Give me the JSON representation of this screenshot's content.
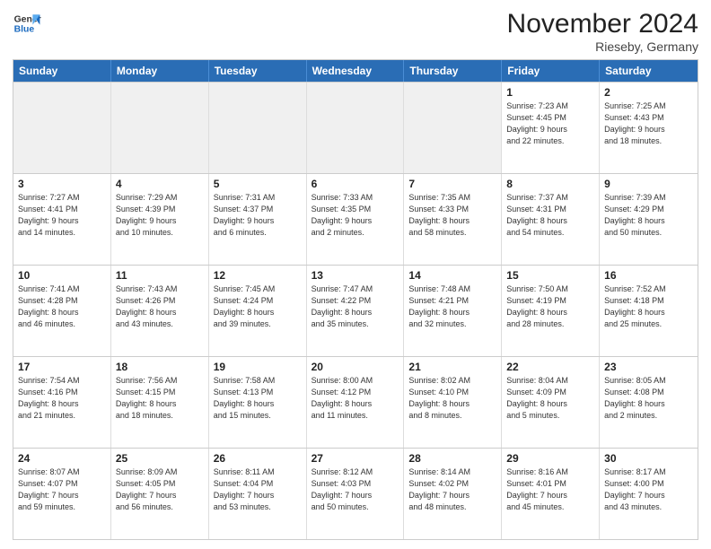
{
  "header": {
    "logo_line1": "General",
    "logo_line2": "Blue",
    "month_title": "November 2024",
    "location": "Rieseby, Germany"
  },
  "weekdays": [
    "Sunday",
    "Monday",
    "Tuesday",
    "Wednesday",
    "Thursday",
    "Friday",
    "Saturday"
  ],
  "weeks": [
    [
      {
        "day": "",
        "info": ""
      },
      {
        "day": "",
        "info": ""
      },
      {
        "day": "",
        "info": ""
      },
      {
        "day": "",
        "info": ""
      },
      {
        "day": "",
        "info": ""
      },
      {
        "day": "1",
        "info": "Sunrise: 7:23 AM\nSunset: 4:45 PM\nDaylight: 9 hours\nand 22 minutes."
      },
      {
        "day": "2",
        "info": "Sunrise: 7:25 AM\nSunset: 4:43 PM\nDaylight: 9 hours\nand 18 minutes."
      }
    ],
    [
      {
        "day": "3",
        "info": "Sunrise: 7:27 AM\nSunset: 4:41 PM\nDaylight: 9 hours\nand 14 minutes."
      },
      {
        "day": "4",
        "info": "Sunrise: 7:29 AM\nSunset: 4:39 PM\nDaylight: 9 hours\nand 10 minutes."
      },
      {
        "day": "5",
        "info": "Sunrise: 7:31 AM\nSunset: 4:37 PM\nDaylight: 9 hours\nand 6 minutes."
      },
      {
        "day": "6",
        "info": "Sunrise: 7:33 AM\nSunset: 4:35 PM\nDaylight: 9 hours\nand 2 minutes."
      },
      {
        "day": "7",
        "info": "Sunrise: 7:35 AM\nSunset: 4:33 PM\nDaylight: 8 hours\nand 58 minutes."
      },
      {
        "day": "8",
        "info": "Sunrise: 7:37 AM\nSunset: 4:31 PM\nDaylight: 8 hours\nand 54 minutes."
      },
      {
        "day": "9",
        "info": "Sunrise: 7:39 AM\nSunset: 4:29 PM\nDaylight: 8 hours\nand 50 minutes."
      }
    ],
    [
      {
        "day": "10",
        "info": "Sunrise: 7:41 AM\nSunset: 4:28 PM\nDaylight: 8 hours\nand 46 minutes."
      },
      {
        "day": "11",
        "info": "Sunrise: 7:43 AM\nSunset: 4:26 PM\nDaylight: 8 hours\nand 43 minutes."
      },
      {
        "day": "12",
        "info": "Sunrise: 7:45 AM\nSunset: 4:24 PM\nDaylight: 8 hours\nand 39 minutes."
      },
      {
        "day": "13",
        "info": "Sunrise: 7:47 AM\nSunset: 4:22 PM\nDaylight: 8 hours\nand 35 minutes."
      },
      {
        "day": "14",
        "info": "Sunrise: 7:48 AM\nSunset: 4:21 PM\nDaylight: 8 hours\nand 32 minutes."
      },
      {
        "day": "15",
        "info": "Sunrise: 7:50 AM\nSunset: 4:19 PM\nDaylight: 8 hours\nand 28 minutes."
      },
      {
        "day": "16",
        "info": "Sunrise: 7:52 AM\nSunset: 4:18 PM\nDaylight: 8 hours\nand 25 minutes."
      }
    ],
    [
      {
        "day": "17",
        "info": "Sunrise: 7:54 AM\nSunset: 4:16 PM\nDaylight: 8 hours\nand 21 minutes."
      },
      {
        "day": "18",
        "info": "Sunrise: 7:56 AM\nSunset: 4:15 PM\nDaylight: 8 hours\nand 18 minutes."
      },
      {
        "day": "19",
        "info": "Sunrise: 7:58 AM\nSunset: 4:13 PM\nDaylight: 8 hours\nand 15 minutes."
      },
      {
        "day": "20",
        "info": "Sunrise: 8:00 AM\nSunset: 4:12 PM\nDaylight: 8 hours\nand 11 minutes."
      },
      {
        "day": "21",
        "info": "Sunrise: 8:02 AM\nSunset: 4:10 PM\nDaylight: 8 hours\nand 8 minutes."
      },
      {
        "day": "22",
        "info": "Sunrise: 8:04 AM\nSunset: 4:09 PM\nDaylight: 8 hours\nand 5 minutes."
      },
      {
        "day": "23",
        "info": "Sunrise: 8:05 AM\nSunset: 4:08 PM\nDaylight: 8 hours\nand 2 minutes."
      }
    ],
    [
      {
        "day": "24",
        "info": "Sunrise: 8:07 AM\nSunset: 4:07 PM\nDaylight: 7 hours\nand 59 minutes."
      },
      {
        "day": "25",
        "info": "Sunrise: 8:09 AM\nSunset: 4:05 PM\nDaylight: 7 hours\nand 56 minutes."
      },
      {
        "day": "26",
        "info": "Sunrise: 8:11 AM\nSunset: 4:04 PM\nDaylight: 7 hours\nand 53 minutes."
      },
      {
        "day": "27",
        "info": "Sunrise: 8:12 AM\nSunset: 4:03 PM\nDaylight: 7 hours\nand 50 minutes."
      },
      {
        "day": "28",
        "info": "Sunrise: 8:14 AM\nSunset: 4:02 PM\nDaylight: 7 hours\nand 48 minutes."
      },
      {
        "day": "29",
        "info": "Sunrise: 8:16 AM\nSunset: 4:01 PM\nDaylight: 7 hours\nand 45 minutes."
      },
      {
        "day": "30",
        "info": "Sunrise: 8:17 AM\nSunset: 4:00 PM\nDaylight: 7 hours\nand 43 minutes."
      }
    ]
  ]
}
